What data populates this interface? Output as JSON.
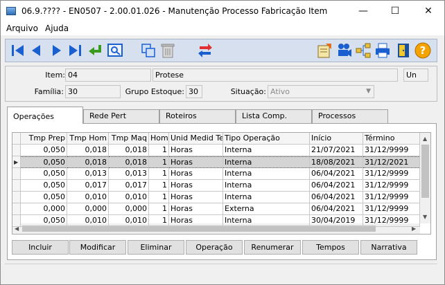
{
  "window": {
    "title": "06.9.???? - EN0507 - 2.00.01.026 - Manutenção Processo Fabricação Item",
    "minimize": "—",
    "maximize": "☐",
    "close": "✕"
  },
  "menu": {
    "file": "Arquivo",
    "help": "Ajuda"
  },
  "toolbar": {
    "icons": [
      "first-record-icon",
      "previous-record-icon",
      "next-record-icon",
      "last-record-icon",
      "goto-record-icon",
      "search-icon",
      "copy-icon",
      "delete-icon",
      "refresh-icon",
      "report-icon",
      "film-camera-icon",
      "tree-icon",
      "print-icon",
      "exit-door-icon",
      "help-icon"
    ],
    "help_glyph": "?"
  },
  "header": {
    "item_label": "Item:",
    "item_code": "04",
    "item_desc": "Protese",
    "item_unit": "Un",
    "family_label": "Família:",
    "family_value": "30",
    "stock_group_label": "Grupo Estoque:",
    "stock_group_value": "30",
    "situation_label": "Situação:",
    "situation_value": "Ativo"
  },
  "tabs": [
    "Operações",
    "Rede Pert",
    "Roteiros",
    "Lista Comp.",
    "Processos"
  ],
  "grid": {
    "columns": [
      "",
      "Tmp Prep",
      "Tmp Hom",
      "Tmp Maq",
      "Hom",
      "Unid Medid Tempo",
      "Tipo Operação",
      "Início",
      "Término"
    ],
    "rows": [
      [
        "0,050",
        "0,018",
        "0,018",
        "1",
        "Horas",
        "Interna",
        "21/07/2021",
        "31/12/9999"
      ],
      [
        "0,050",
        "0,018",
        "0,018",
        "1",
        "Horas",
        "Interna",
        "18/08/2021",
        "31/12/2021"
      ],
      [
        "0,050",
        "0,013",
        "0,013",
        "1",
        "Horas",
        "Interna",
        "06/04/2021",
        "31/12/9999"
      ],
      [
        "0,050",
        "0,017",
        "0,017",
        "1",
        "Horas",
        "Interna",
        "06/04/2021",
        "31/12/9999"
      ],
      [
        "0,050",
        "0,010",
        "0,010",
        "1",
        "Horas",
        "Interna",
        "06/04/2021",
        "31/12/9999"
      ],
      [
        "0,000",
        "0,000",
        "0,000",
        "1",
        "Horas",
        "Externa",
        "06/04/2021",
        "31/12/9999"
      ],
      [
        "0,050",
        "0,010",
        "0,010",
        "1",
        "Horas",
        "Interna",
        "30/04/2019",
        "31/12/9999"
      ]
    ],
    "selected_row": 1
  },
  "buttons": [
    "Incluir",
    "Modificar",
    "Eliminar",
    "Operação",
    "Renumerar",
    "Tempos",
    "Narrativa"
  ],
  "colors": {
    "toolbar_bg": "#d6e0ee",
    "selected_row": "#d4d4d4"
  }
}
